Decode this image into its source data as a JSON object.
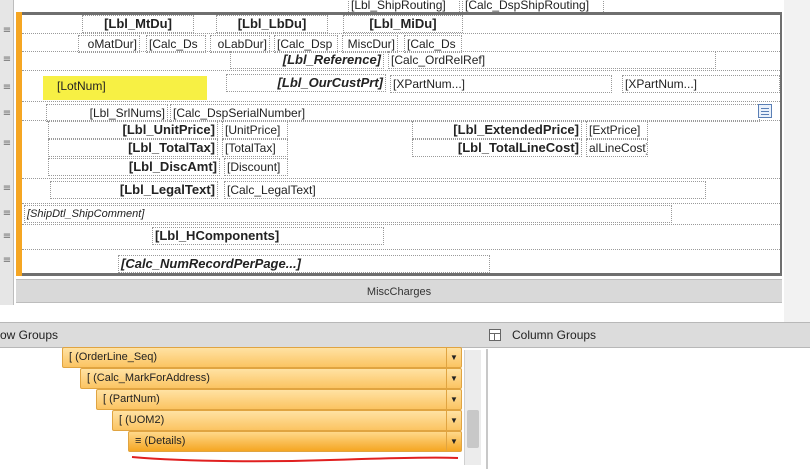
{
  "top_fields": {
    "ship_routing_label": "[Lbl_ShipRouting]",
    "calc_ship_routing": "[Calc_DspShipRouting]"
  },
  "row1": {
    "lbl_mtdu": "[Lbl_MtDu]",
    "lbl_lbdu": "[Lbl_LbDu]",
    "lbl_midu": "[Lbl_MiDu]"
  },
  "row2": {
    "matdur": "oMatDur]",
    "calc_ds1": "[Calc_Ds",
    "labdur": "oLabDur]",
    "calc_dsp2": "[Calc_Dsp",
    "miscdur": "MiscDur]",
    "calc_ds3": "[Calc_Ds"
  },
  "row3": {
    "lbl_reference": "[Lbl_Reference]",
    "calc_ordrelref": "[Calc_OrdRelRef]"
  },
  "row4": {
    "lotnum": "[LotNum]",
    "lbl_ourcustprt": "[Lbl_OurCustPrt]",
    "xpartnum1": "[XPartNum...]",
    "xpartnum2": "[XPartNum...]"
  },
  "row5": {
    "lbl_srlnums": "[Lbl_SrlNums]",
    "calc_dspserial": "[Calc_DspSerialNumber]"
  },
  "row6": {
    "lbl_unitprice": "[Lbl_UnitPrice]",
    "unitprice": "[UnitPrice]",
    "lbl_extprice": "[Lbl_ExtendedPrice]",
    "extprice": "[ExtPrice]"
  },
  "row7": {
    "lbl_totaltax": "[Lbl_TotalTax]",
    "totaltax": "[TotalTax]",
    "lbl_totallinecost": "[Lbl_TotalLineCost]",
    "linecost": "alLineCost]"
  },
  "row8": {
    "lbl_discamt": "[Lbl_DiscAmt]",
    "discount": "[Discount]"
  },
  "row9": {
    "lbl_legaltext": "[Lbl_LegalText]",
    "calc_legaltext": "[Calc_LegalText]"
  },
  "row10": {
    "shipcomment": "[ShipDtl_ShipComment]"
  },
  "row11": {
    "lbl_hcomponents": "[Lbl_HComponents]"
  },
  "row12": {
    "calc_numrecord": "[Calc_NumRecordPerPage...]"
  },
  "misc_charges": "MiscCharges",
  "panes": {
    "row_groups_title": "ow Groups",
    "column_groups_title": "Column Groups"
  },
  "row_groups": [
    {
      "label": "(OrderLine_Seq)"
    },
    {
      "label": "(Calc_MarkForAddress)"
    },
    {
      "label": "(PartNum)"
    },
    {
      "label": "(UOM2)"
    },
    {
      "label": "(Details)"
    }
  ],
  "colors": {
    "highlight": "#f7ef3a",
    "group_orange": "#fbc462",
    "annotation_red": "#e02020"
  }
}
